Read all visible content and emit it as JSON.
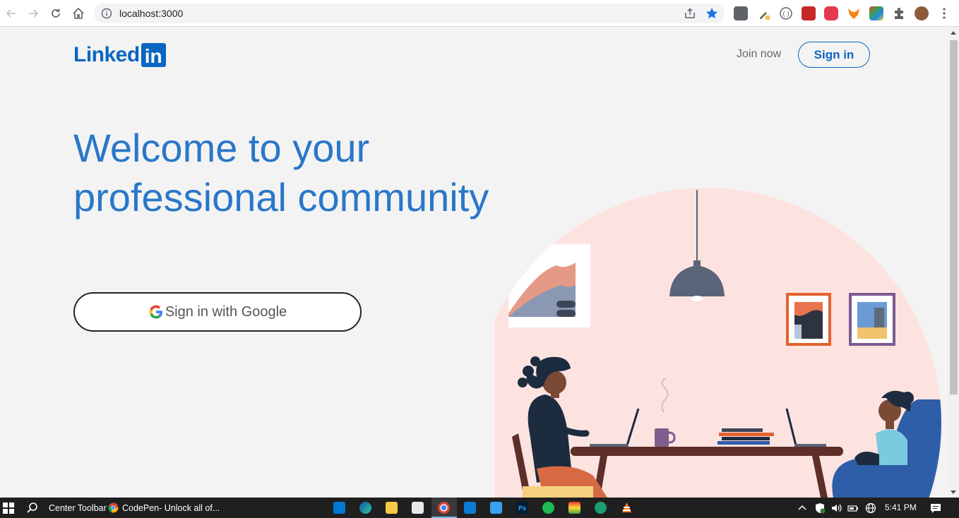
{
  "browser": {
    "url": "localhost:3000"
  },
  "header": {
    "logo_word": "Linked",
    "logo_box": "in",
    "join_now": "Join now",
    "sign_in": "Sign in"
  },
  "hero": {
    "headline_line1": "Welcome to your",
    "headline_line2": "professional community",
    "google_button": "Sign in with Google"
  },
  "taskbar": {
    "search_label": "Center Toolbar",
    "window_title": "CodePen- Unlock all of...",
    "time": "5:41 PM"
  },
  "colors": {
    "brand": "#0a66c2",
    "headline": "#2977c9",
    "illustration_bg": "#fde3e0"
  }
}
